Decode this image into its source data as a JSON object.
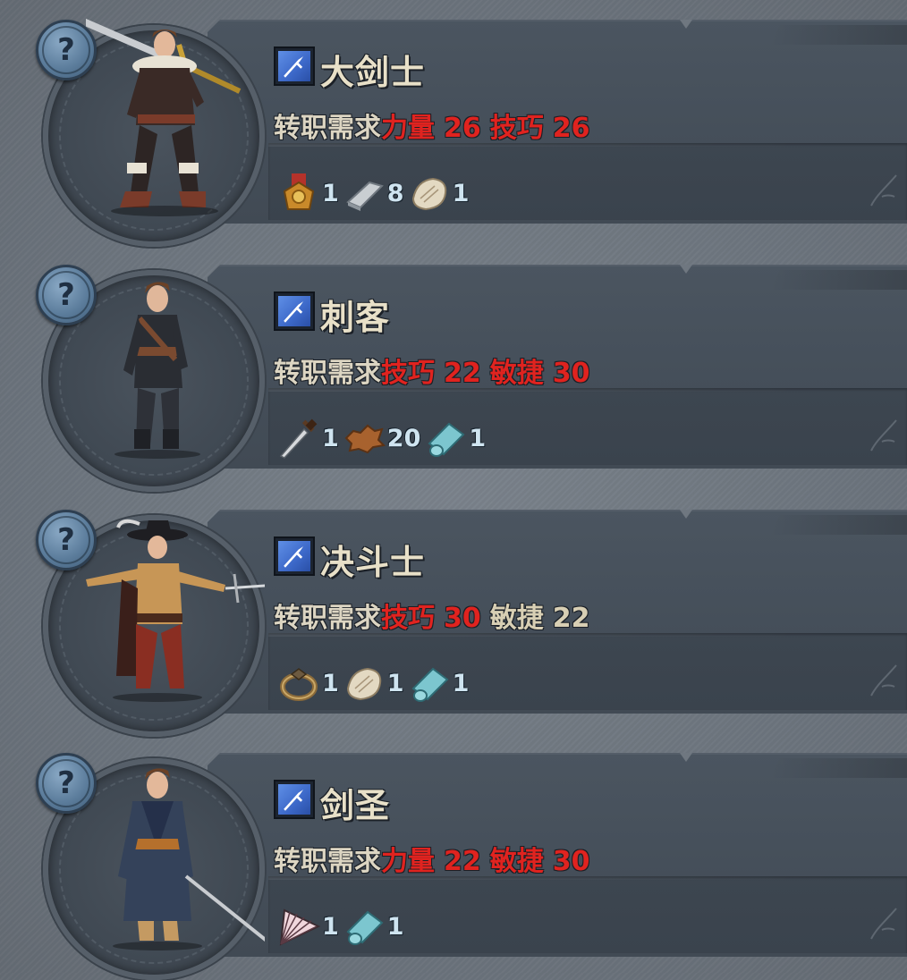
{
  "jobs": [
    {
      "name": "大剑士",
      "requirement_label": "转职需求",
      "requirements": [
        {
          "stat": "力量",
          "value": "26",
          "met": false
        },
        {
          "stat": "技巧",
          "value": "26",
          "met": false
        }
      ],
      "materials": [
        {
          "icon": "medal-icon",
          "count": "1"
        },
        {
          "icon": "whetstone-icon",
          "count": "8"
        },
        {
          "icon": "fur-pelt-icon",
          "count": "1"
        }
      ]
    },
    {
      "name": "刺客",
      "requirement_label": "转职需求",
      "requirements": [
        {
          "stat": "技巧",
          "value": "22",
          "met": false
        },
        {
          "stat": "敏捷",
          "value": "30",
          "met": false
        }
      ],
      "materials": [
        {
          "icon": "dagger-icon",
          "count": "1"
        },
        {
          "icon": "leather-hide-icon",
          "count": "20"
        },
        {
          "icon": "cloth-roll-icon",
          "count": "1"
        }
      ]
    },
    {
      "name": "决斗士",
      "requirement_label": "转职需求",
      "requirements": [
        {
          "stat": "技巧",
          "value": "30",
          "met": false
        },
        {
          "stat": "敏捷",
          "value": "22",
          "met": true
        }
      ],
      "materials": [
        {
          "icon": "ring-icon",
          "count": "1"
        },
        {
          "icon": "fur-pelt-icon",
          "count": "1"
        },
        {
          "icon": "cloth-roll-icon",
          "count": "1"
        }
      ]
    },
    {
      "name": "剑圣",
      "requirement_label": "转职需求",
      "requirements": [
        {
          "stat": "力量",
          "value": "22",
          "met": false
        },
        {
          "stat": "敏捷",
          "value": "30",
          "met": false
        }
      ],
      "materials": [
        {
          "icon": "fan-icon",
          "count": "1"
        },
        {
          "icon": "cloth-roll-icon",
          "count": "1"
        }
      ]
    }
  ],
  "help_symbol": "?",
  "colors": {
    "unmet": "#e0231f",
    "met": "#d8cfb4",
    "class_icon": "#4a7bdc",
    "help_button": "#6b8db0"
  }
}
